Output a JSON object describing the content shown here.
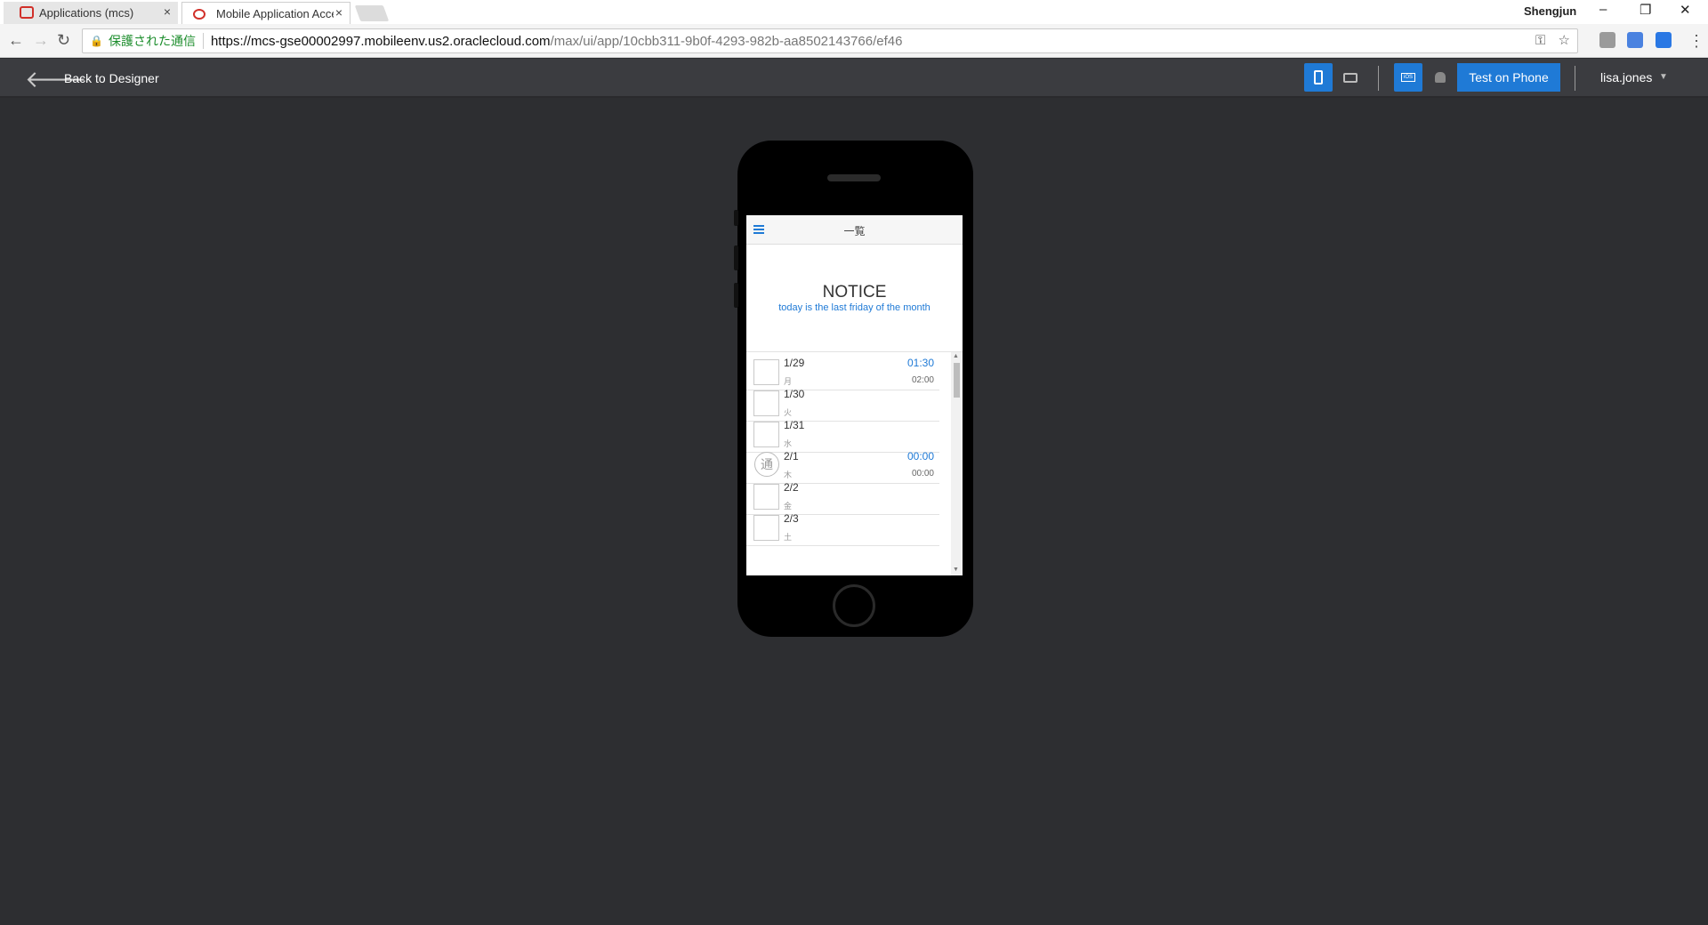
{
  "browser": {
    "tabs": [
      {
        "title": "Applications (mcs)",
        "close": "×"
      },
      {
        "title": "Mobile Application Accelerator",
        "close": "×"
      }
    ],
    "profile_name": "Shengjun",
    "window_controls": {
      "minimize": "–",
      "restore": "❐",
      "close": "✕"
    },
    "nav": {
      "back": "←",
      "forward": "→",
      "reload": "↻"
    },
    "security_label": "保護された通信",
    "url_host": "https://mcs-gse00002997.mobileenv.us2.oraclecloud.com",
    "url_path": "/max/ui/app/10cbb311-9b0f-4293-982b-aa8502143766/ef46",
    "omnibox_icons": {
      "key": "⚿",
      "star": "☆"
    },
    "menu": "⋮"
  },
  "toolbar": {
    "back_label": "Back to Designer",
    "back_arrow": "🡐",
    "test_button": "Test on Phone",
    "user_name": "lisa.jones",
    "user_caret": "▼",
    "ios_label": "iOS"
  },
  "screen": {
    "header_title": "一覧",
    "notice_title": "NOTICE",
    "notice_subtitle": "today is the last friday of the month",
    "rows": [
      {
        "date": "1/29",
        "day": "月",
        "time_start": "01:30",
        "time_end": "02:00",
        "mark": ""
      },
      {
        "date": "1/30",
        "day": "火",
        "time_start": "",
        "time_end": "",
        "mark": ""
      },
      {
        "date": "1/31",
        "day": "水",
        "time_start": "",
        "time_end": "",
        "mark": ""
      },
      {
        "date": "2/1",
        "day": "木",
        "time_start": "00:00",
        "time_end": "00:00",
        "mark": "通"
      },
      {
        "date": "2/2",
        "day": "金",
        "time_start": "",
        "time_end": "",
        "mark": ""
      },
      {
        "date": "2/3",
        "day": "土",
        "time_start": "",
        "time_end": "",
        "mark": ""
      }
    ],
    "scroll_up": "▲",
    "scroll_down": "▼"
  },
  "colors": {
    "accent": "#1f7ad6",
    "background": "#2d2e31",
    "toolbar": "#3b3c40",
    "secure_green": "#1c8d2c"
  }
}
